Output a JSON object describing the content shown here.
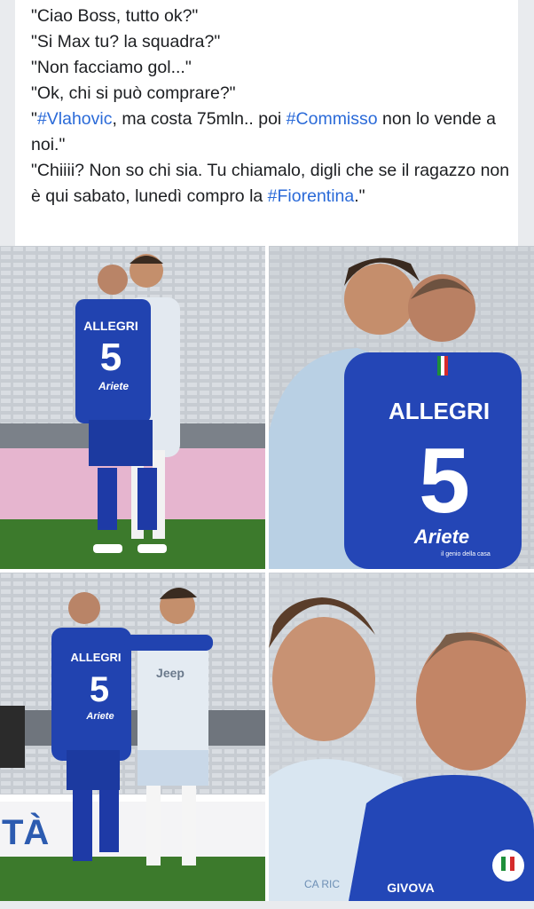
{
  "post": {
    "lines": [
      {
        "text": "\"Ciao Boss, tutto ok?\""
      },
      {
        "text": "\"Si Max tu? la squadra?\""
      },
      {
        "text": "\"Non facciamo gol...\""
      },
      {
        "text": "\"Ok, chi si può comprare?\""
      }
    ],
    "line5": {
      "pre": "\"",
      "tag1": "#Vlahovic",
      "mid": ", ma costa 75mln.. poi ",
      "tag2": "#Commisso",
      "post": " non lo vende a noi.\""
    },
    "line6": {
      "pre": "\"Chiiii? Non so chi sia. Tu chiamalo, digli che se il ragazzo non è qui sabato, lunedì compro la ",
      "tag": "#Fiorentina",
      "post": ".\""
    }
  },
  "photos": {
    "jersey_name": "ALLEGRI",
    "jersey_number": "5",
    "sponsor": "Ariete",
    "sponsor_tagline": "il genio della casa",
    "opponent_sponsor": "Jeep",
    "kit_brand": "GIVOVA",
    "banner_text": "TÀ",
    "partial_text": "CA RIC"
  },
  "colors": {
    "accent": "#2a6ad8",
    "jersey_blue": "#1f3fae",
    "kit_light": "#dfe8f1",
    "pitch": "#3b7a2e",
    "stands": "#c9cdd2"
  }
}
